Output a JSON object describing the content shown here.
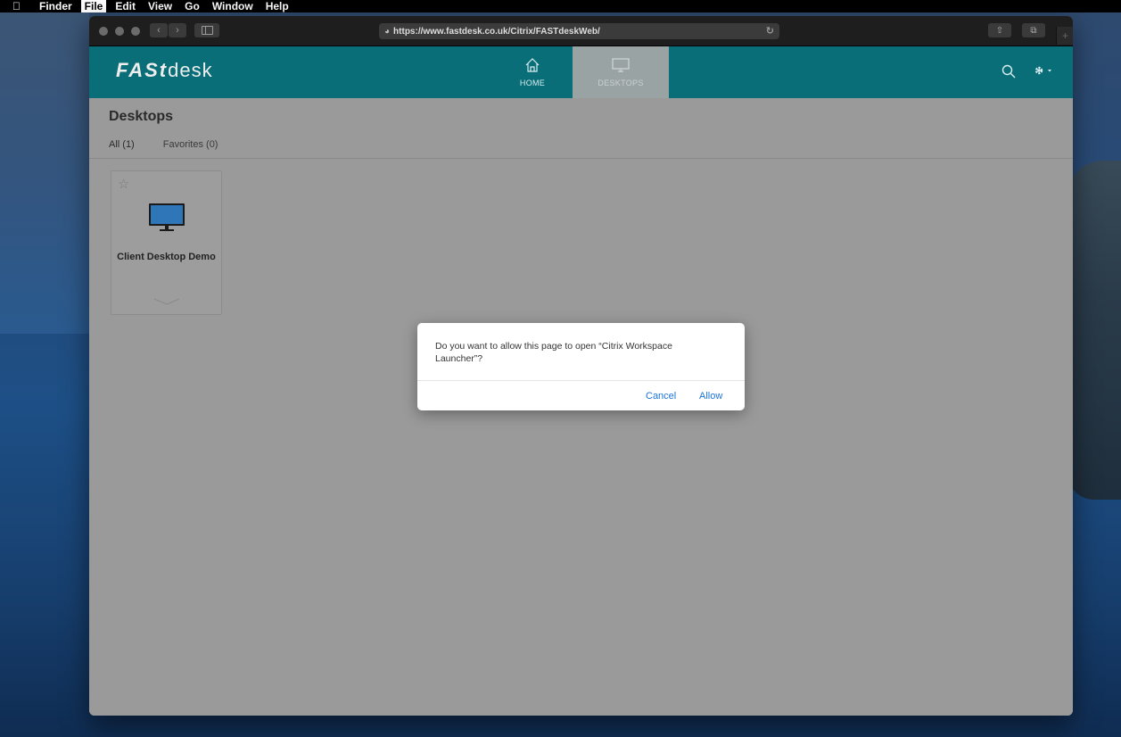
{
  "menubar": {
    "app": "Finder",
    "items": [
      "File",
      "Edit",
      "View",
      "Go",
      "Window",
      "Help"
    ]
  },
  "browser": {
    "url": "https://www.fastdesk.co.uk/Citrix/FASTdeskWeb/",
    "back_icon": "chevron-left-icon",
    "forward_icon": "chevron-right-icon"
  },
  "app_header": {
    "logo_bold": "FASt",
    "logo_light": "desk",
    "tabs": [
      {
        "label": "HOME",
        "icon": "home-icon"
      },
      {
        "label": "DESKTOPS",
        "icon": "monitor-icon",
        "active": true
      }
    ],
    "accent_color": "#0a6e78"
  },
  "main": {
    "title": "Desktops",
    "filters": [
      "All (1)",
      "Favorites (0)"
    ],
    "tiles": [
      {
        "name": "Client Desktop Demo",
        "icon": "desktop-monitor-icon",
        "favorite": false
      }
    ]
  },
  "dialog": {
    "message": "Do you want to allow this page to open “Citrix Workspace Launcher”?",
    "cancel_label": "Cancel",
    "allow_label": "Allow",
    "button_color": "#1a73d9"
  }
}
